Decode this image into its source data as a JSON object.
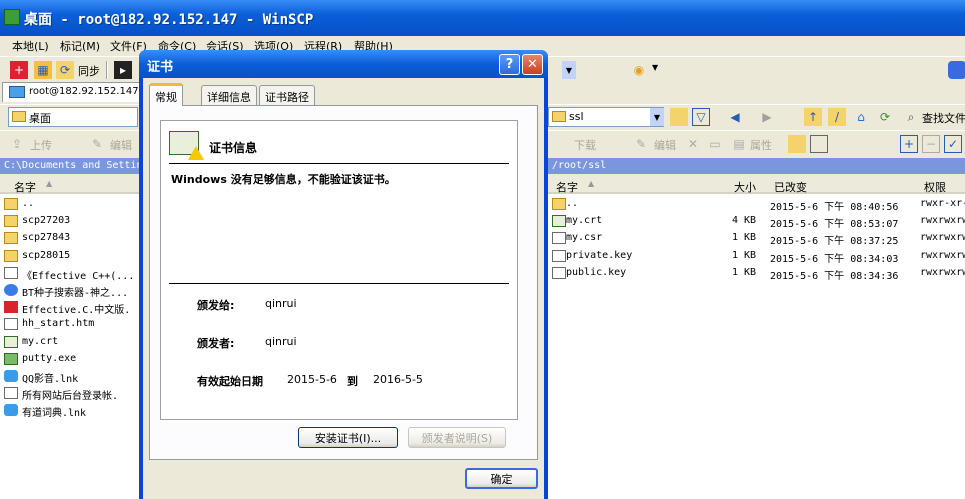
{
  "window": {
    "title": "桌面 - root@182.92.152.147 - WinSCP"
  },
  "menu": [
    "本地(L)",
    "标记(M)",
    "文件(F)",
    "命令(C)",
    "会话(S)",
    "选项(O)",
    "远程(R)",
    "帮助(H)"
  ],
  "toolbar": {
    "sync_label": "同步"
  },
  "session_tab": {
    "label": "root@182.92.152.147"
  },
  "local": {
    "path": "桌面",
    "upload_label": "上传",
    "edit_label": "编辑",
    "address": "C:\\Documents and Settings",
    "col_name": "名字",
    "files": [
      {
        "name": "..",
        "icon": "up-folder-icon"
      },
      {
        "name": "scp27203",
        "icon": "folder-icon"
      },
      {
        "name": "scp27843",
        "icon": "folder-icon"
      },
      {
        "name": "scp28015",
        "icon": "folder-icon"
      },
      {
        "name": "《Effective C++(...",
        "icon": "document-icon"
      },
      {
        "name": "BT种子搜索器-神之...",
        "icon": "web-icon"
      },
      {
        "name": "Effective.C.中文版.",
        "icon": "pdf-icon"
      },
      {
        "name": "hh_start.htm",
        "icon": "html-icon"
      },
      {
        "name": "my.crt",
        "icon": "certificate-icon"
      },
      {
        "name": "putty.exe",
        "icon": "putty-icon"
      },
      {
        "name": "QQ影音.lnk",
        "icon": "shortcut-icon"
      },
      {
        "name": "所有网站后台登录帐.",
        "icon": "text-file-icon"
      },
      {
        "name": "有道词典.lnk",
        "icon": "shortcut-icon"
      }
    ]
  },
  "remote": {
    "path": "ssl",
    "find_label": "查找文件",
    "download_label": "下载",
    "edit_label": "编辑",
    "properties_label": "属性",
    "address": "/root/ssl",
    "columns": {
      "name": "名字",
      "size": "大小",
      "changed": "已改变",
      "rights": "权限"
    },
    "files": [
      {
        "name": "..",
        "size": "",
        "changed": "2015-5-6 下午 08:40:56",
        "rights": "rwxr-xr-",
        "icon": "up-folder-icon"
      },
      {
        "name": "my.crt",
        "size": "4 KB",
        "changed": "2015-5-6 下午 08:53:07",
        "rights": "rwxrwxrw",
        "icon": "certificate-icon"
      },
      {
        "name": "my.csr",
        "size": "1 KB",
        "changed": "2015-5-6 下午 08:37:25",
        "rights": "rwxrwxrw",
        "icon": "file-icon"
      },
      {
        "name": "private.key",
        "size": "1 KB",
        "changed": "2015-5-6 下午 08:34:03",
        "rights": "rwxrwxrw",
        "icon": "file-icon"
      },
      {
        "name": "public.key",
        "size": "1 KB",
        "changed": "2015-5-6 下午 08:34:36",
        "rights": "rwxrwxrw",
        "icon": "file-icon"
      }
    ]
  },
  "dialog": {
    "title": "证书",
    "help": "?",
    "close": "✕",
    "tabs": [
      "常规",
      "详细信息",
      "证书路径"
    ],
    "heading": "证书信息",
    "warning": "Windows 没有足够信息，不能验证该证书。",
    "issued_to_label": "颁发给:",
    "issued_to": "qinrui",
    "issued_by_label": "颁发者:",
    "issued_by": "qinrui",
    "valid_label": "有效起始日期",
    "valid_from": "2015-5-6",
    "valid_to_label": "到",
    "valid_to": "2016-5-5",
    "install_button": "安装证书(I)...",
    "issuer_statement_button": "颁发者说明(S)",
    "ok_button": "确定"
  }
}
